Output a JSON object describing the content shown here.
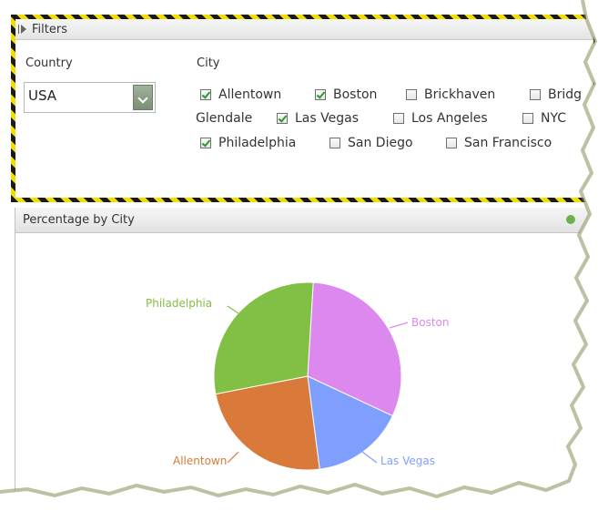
{
  "filters": {
    "title": "Filters",
    "country_label": "Country",
    "country_value": "USA",
    "city_label": "City",
    "cities": [
      {
        "label": "Allentown",
        "checked": true
      },
      {
        "label": "Boston",
        "checked": true
      },
      {
        "label": "Brickhaven",
        "checked": false
      },
      {
        "label": "Bridg",
        "checked": false
      },
      {
        "label": "Glendale",
        "checked": null
      },
      {
        "label": "Las Vegas",
        "checked": true
      },
      {
        "label": "Los Angeles",
        "checked": false
      },
      {
        "label": "NYC",
        "checked": false
      },
      {
        "label": "Philadelphia",
        "checked": true
      },
      {
        "label": "San Diego",
        "checked": false
      },
      {
        "label": "San Francisco",
        "checked": false
      }
    ]
  },
  "chart_panel": {
    "title": "Percentage by City"
  },
  "chart_data": {
    "type": "pie",
    "title": "Percentage by City",
    "slices": [
      {
        "label": "Boston",
        "value": 31,
        "color": "#dd88ee"
      },
      {
        "label": "Las Vegas",
        "value": 16,
        "color": "#7f9fff"
      },
      {
        "label": "Allentown",
        "value": 24,
        "color": "#d97a3a"
      },
      {
        "label": "Philadelphia",
        "value": 29,
        "color": "#82bf45"
      }
    ]
  },
  "colors": {
    "highlight_border": "#f2dd00",
    "checkmark": "#2a9a2a"
  }
}
